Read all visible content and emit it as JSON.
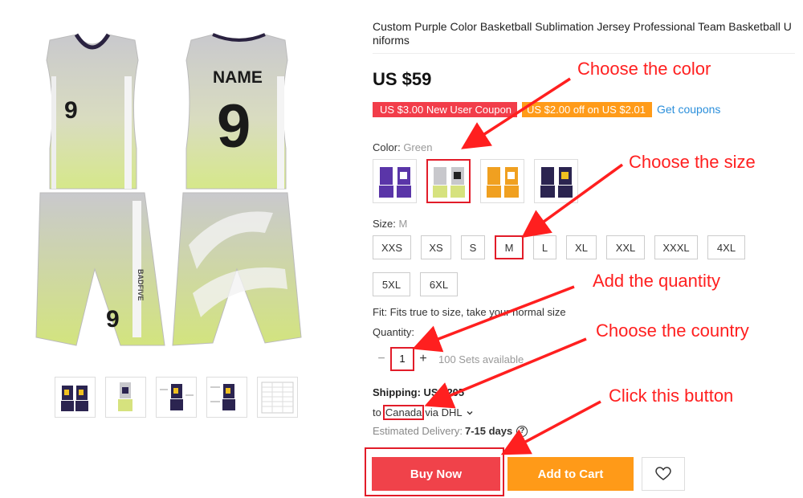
{
  "product": {
    "title": "Custom Purple Color Basketball Sublimation Jersey Professional Team Basketball Uniforms",
    "price": "US $59",
    "jersey_name": "NAME",
    "jersey_number": "9",
    "brand_text": "BADFIVE"
  },
  "coupons": {
    "new_user": "US $3.00 New User Coupon",
    "discount": "US $2.00 off on US $2.01",
    "get_link": "Get coupons"
  },
  "color": {
    "label": "Color:",
    "selected": "Green",
    "options": [
      "purple",
      "green",
      "orange",
      "navy"
    ]
  },
  "size": {
    "label": "Size:",
    "selected": "M",
    "options": [
      "XXS",
      "XS",
      "S",
      "M",
      "L",
      "XL",
      "XXL",
      "XXXL",
      "4XL",
      "5XL",
      "6XL"
    ]
  },
  "fit_text": "Fit: Fits true to size, take your normal size",
  "quantity": {
    "label": "Quantity:",
    "value": "1",
    "minus": "−",
    "plus": "+",
    "available": "100 Sets available"
  },
  "shipping": {
    "label": "Shipping: US $2",
    "label_tail": "05",
    "to": "to",
    "country": "Canada",
    "via": "via DHL",
    "delivery_label": "Estimated Delivery:",
    "delivery_days": "7-15 days",
    "help_glyph": "?"
  },
  "actions": {
    "buy_now": "Buy Now",
    "add_to_cart": "Add to Cart"
  },
  "annotations": {
    "color": "Choose the color",
    "size": "Choose the size",
    "quantity": "Add the quantity",
    "country": "Choose the country",
    "button": "Click this button"
  },
  "colors": {
    "accent_red": "#e21c29",
    "buy_now": "#f0424a",
    "add_to_cart": "#ff9a18",
    "coupon_red": "#f23d4a",
    "coupon_orange": "#ff9b19",
    "link_blue": "#2b8fdb",
    "annotation_red": "#ff1f1f"
  },
  "icons": {
    "wishlist": "heart-icon",
    "carrier_dropdown": "chevron-down-icon",
    "delivery_help": "help-circle-icon"
  }
}
